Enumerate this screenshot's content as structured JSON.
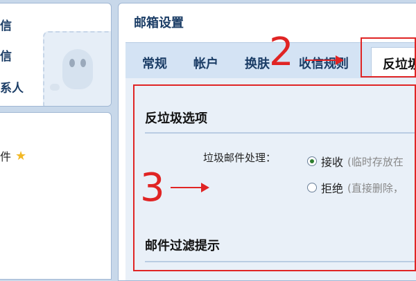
{
  "sidebar": {
    "items": [
      {
        "label": "信"
      },
      {
        "label": "信"
      },
      {
        "label": "系人"
      }
    ],
    "bottom_item": {
      "label": "件"
    }
  },
  "main": {
    "title": "邮箱设置",
    "tabs": [
      {
        "label": "常规"
      },
      {
        "label": "帐户"
      },
      {
        "label": "换肤"
      },
      {
        "label": "收信规则"
      },
      {
        "label": "反垃圾"
      }
    ],
    "active_tab": "反垃圾"
  },
  "antispam": {
    "section_title": "反垃圾选项",
    "field_label": "垃圾邮件处理：",
    "options": [
      {
        "label": "接收",
        "hint": "(临时存放在",
        "selected": true
      },
      {
        "label": "拒绝",
        "hint": "(直接删除，",
        "selected": false
      }
    ]
  },
  "filter": {
    "section_title": "邮件过滤提示"
  },
  "annotations": {
    "step2": "2",
    "step3": "3"
  },
  "colors": {
    "annotation": "#e02424",
    "tab_bar": "#d4e3f4",
    "content_bg": "#e9f0f8",
    "background": "#c8d8ea"
  }
}
